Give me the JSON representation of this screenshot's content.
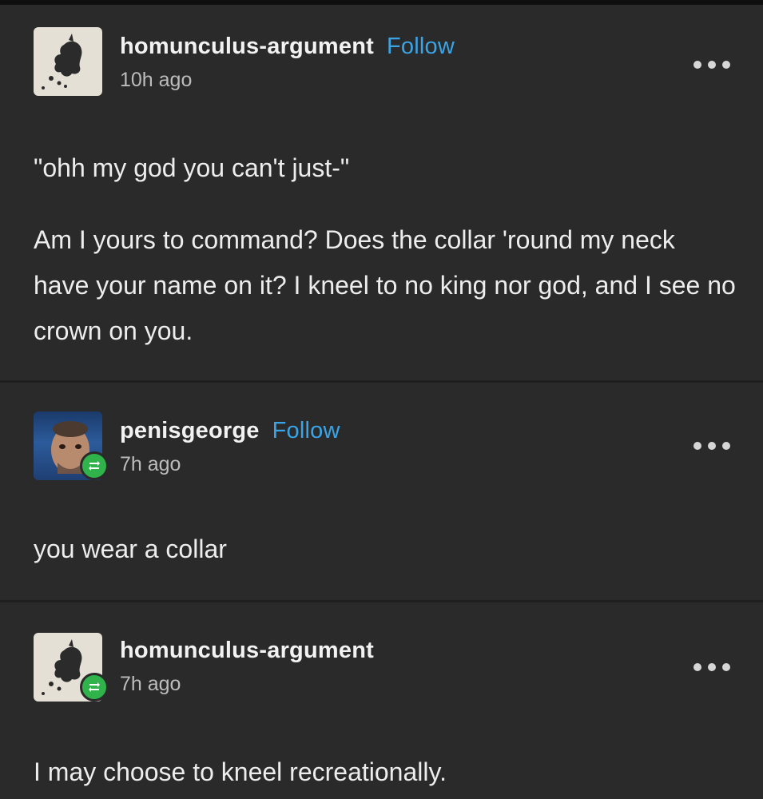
{
  "posts": [
    {
      "username": "homunculus-argument",
      "follow_label": "Follow",
      "timestamp": "10h ago",
      "avatar_icon": "sketch-creature-avatar",
      "reblogged": false,
      "paragraphs": [
        "\"ohh my god you can't just-\"",
        "Am I yours to command? Does the collar 'round my neck have your name on it? I kneel to no king nor god, and I see no crown on you."
      ]
    },
    {
      "username": "penisgeorge",
      "follow_label": "Follow",
      "timestamp": "7h ago",
      "avatar_icon": "photo-face-avatar",
      "reblogged": true,
      "paragraphs": [
        "you wear a collar"
      ]
    },
    {
      "username": "homunculus-argument",
      "follow_label": "",
      "timestamp": "7h ago",
      "avatar_icon": "sketch-creature-avatar",
      "reblogged": true,
      "paragraphs": [
        "I may choose to kneel recreationally."
      ]
    }
  ],
  "colors": {
    "background": "#2a2a2b",
    "follow": "#3aa4e6",
    "reblog_badge": "#2fb34a"
  },
  "icons": {
    "more": "more-options-icon",
    "reblog": "reblog-icon"
  }
}
